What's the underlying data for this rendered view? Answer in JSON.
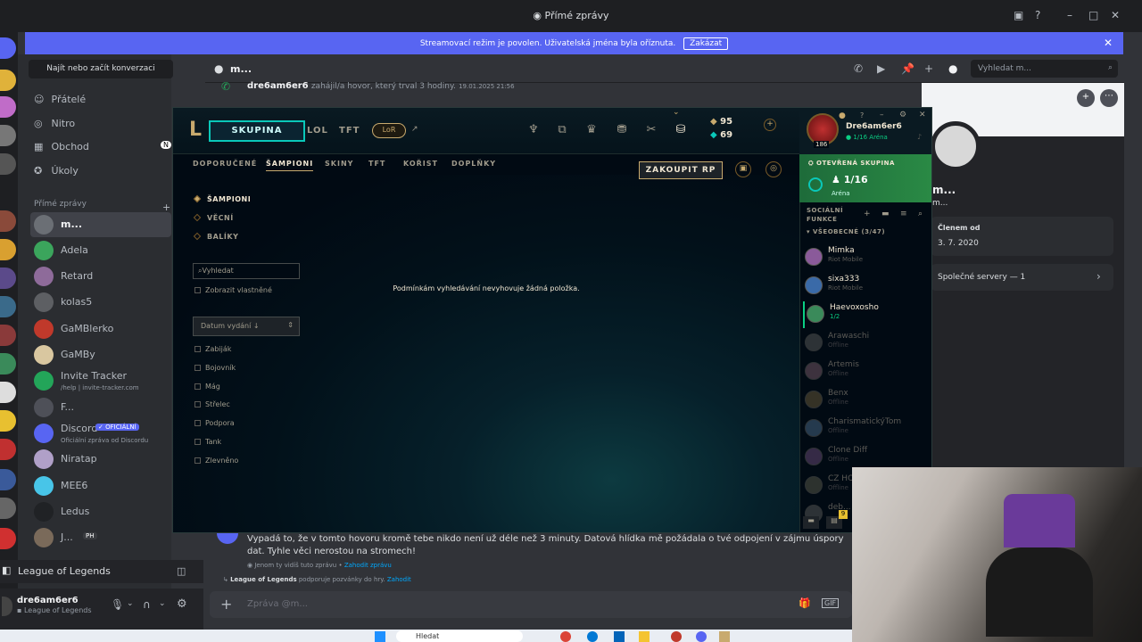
{
  "window": {
    "title": "Přímé zprávy"
  },
  "banner": {
    "text": "Streamovací režim je povolen. Uživatelská jména byla oříznuta.",
    "disable": "Zakázat"
  },
  "sidebar": {
    "find": "Najít nebo začít konverzaci",
    "nav": [
      {
        "label": "Přátelé",
        "icon": "friends-icon"
      },
      {
        "label": "Nitro",
        "icon": "nitro-icon"
      },
      {
        "label": "Obchod",
        "icon": "shop-icon",
        "badge": "N"
      },
      {
        "label": "Úkoly",
        "icon": "quests-icon"
      }
    ],
    "dm_header": "Přímé zprávy",
    "dms": [
      {
        "name": "m...",
        "sub": "",
        "color": "#6b6f75"
      },
      {
        "name": "Adela",
        "sub": "",
        "color": "#3ba55c"
      },
      {
        "name": "Retard",
        "sub": "",
        "color": "#8e6b9a"
      },
      {
        "name": "kolas5",
        "sub": "",
        "color": "#5d5f63"
      },
      {
        "name": "GaMBlerko",
        "sub": "",
        "color": "#c0392b"
      },
      {
        "name": "GaMBy",
        "sub": "",
        "color": "#d9c7a0"
      },
      {
        "name": "Invite Tracker",
        "sub": "/help | invite-tracker.com",
        "color": "#23a559"
      },
      {
        "name": "F...",
        "sub": "",
        "color": "#4e5058"
      },
      {
        "name": "Discord",
        "sub": "Oficiální zpráva od Discordu",
        "color": "#5865f2",
        "badge": "✓ OFICIÁLNÍ"
      },
      {
        "name": "Niratap",
        "sub": "",
        "color": "#b0a0c8"
      },
      {
        "name": "MEE6",
        "sub": "",
        "color": "#48c5e8"
      },
      {
        "name": "Ledus",
        "sub": "",
        "color": "#202225"
      },
      {
        "name": "J...",
        "sub": "",
        "color": "#7a6a5a",
        "badge": "PH"
      }
    ],
    "activity": "League of Legends",
    "user": {
      "name": "dre6am6er6",
      "status": "League of Legends"
    }
  },
  "channel": {
    "name": "m...",
    "search_placeholder": "Vyhledat m...",
    "call_user": "dre6am6er6",
    "call_text": "zahájil/a hovor, který trval 3 hodiny.",
    "call_time": "19.01.2025 21:56",
    "clyde_text": "Vypadá to, že v tomto hovoru kromě tebe nikdo není už déle než 3 minuty. Datová hlídka mě požádala o tvé odpojení v zájmu úspory dat. Tyhle věci nerostou na stromech!",
    "only_you": "Jenom ty vidíš tuto zprávu •",
    "dismiss": "Zahodit zprávu",
    "invite_app": "League of Legends",
    "invite_text": "podporuje pozvánky do hry.",
    "invite_dismiss": "Zahodit",
    "message_placeholder": "Zpráva @m..."
  },
  "profile": {
    "name": "m...",
    "sub": "m...",
    "member_since_label": "Členem od",
    "member_since": "3. 7. 2020",
    "mutual": "Společné servery — 1"
  },
  "taskbar": {
    "search": "Hledat"
  },
  "lol": {
    "play": "SKUPINA",
    "nav": [
      "LOL",
      "TFT"
    ],
    "lor": "LoR",
    "be": "95",
    "rp": "69",
    "summoner": {
      "name": "Dre6am6er6",
      "level": "186",
      "status": "1/16 Aréna"
    },
    "subnav": [
      "DOPORUČENÉ",
      "ŠAMPIONI",
      "SKINY",
      "TFT",
      "KOŘIST",
      "DOPLŇKY"
    ],
    "buy_rp": "ZAKOUPIT RP",
    "categories": [
      "ŠAMPIONI",
      "VĚCNÍ",
      "BALÍKY"
    ],
    "search_placeholder": "Vyhledat",
    "show_owned": "Zobrazit vlastněné",
    "sort": "Datum vydání",
    "roles": [
      "Zabiják",
      "Bojovník",
      "Mág",
      "Střelec",
      "Podpora",
      "Tank",
      "Zlevněno"
    ],
    "no_match": "Podmínkám vyhledávání nevyhovuje žádná položka.",
    "open_group": "OTEVŘENÁ SKUPINA",
    "group_count": "1/16",
    "group_mode": "Aréna",
    "social_title": "SOCIÁLNÍ FUNKCE",
    "general": "VŠEOBECNÉ (3/47)",
    "friends": [
      {
        "name": "Mimka",
        "status": "Riot Mobile",
        "online": true
      },
      {
        "name": "sixa333",
        "status": "Riot Mobile",
        "online": true
      },
      {
        "name": "Haevoxosho",
        "status": "1/2",
        "online": true
      },
      {
        "name": "Arawaschi",
        "status": "Offline",
        "online": false
      },
      {
        "name": "Artemis",
        "status": "Offline",
        "online": false
      },
      {
        "name": "Benx",
        "status": "Offline",
        "online": false
      },
      {
        "name": "CharismatickýTom",
        "status": "Offline",
        "online": false
      },
      {
        "name": "Clone Diff",
        "status": "Offline",
        "online": false
      },
      {
        "name": "CZ HO",
        "status": "Offline",
        "online": false
      },
      {
        "name": "deb...",
        "status": "",
        "online": false
      }
    ],
    "chat_badge": "9"
  }
}
